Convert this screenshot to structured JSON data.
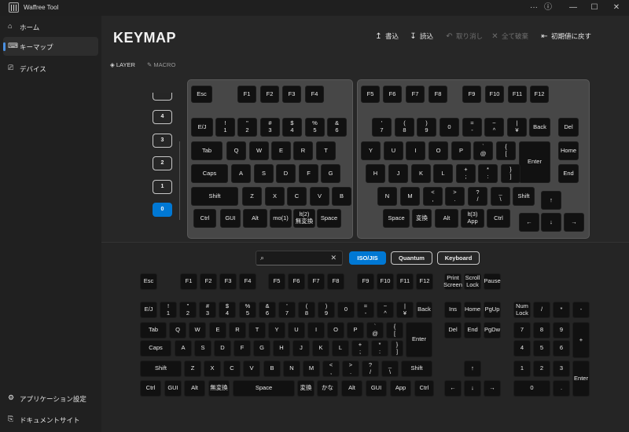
{
  "window": {
    "title": "Waffree Tool",
    "controls": {
      "more": "···",
      "info": "ⓘ",
      "minimize": "—",
      "maximize": "☐",
      "close": "✕"
    }
  },
  "sidebar": {
    "items": [
      {
        "label": "ホーム",
        "icon": "home-icon",
        "glyph": "⌂"
      },
      {
        "label": "キーマップ",
        "icon": "keyboard-icon",
        "glyph": "⌨"
      },
      {
        "label": "デバイス",
        "icon": "device-icon",
        "glyph": "⎚"
      }
    ],
    "footer": [
      {
        "label": "アプリケーション設定",
        "icon": "gear-icon",
        "glyph": "⚙"
      },
      {
        "label": "ドキュメントサイト",
        "icon": "document-icon",
        "glyph": "⎘"
      }
    ]
  },
  "page": {
    "title": "KEYMAP"
  },
  "actions": [
    {
      "label": "書込",
      "glyph": "↥",
      "icon": "upload-icon"
    },
    {
      "label": "読込",
      "glyph": "↧",
      "icon": "download-icon"
    },
    {
      "label": "取り消し",
      "glyph": "↶",
      "icon": "undo-icon"
    },
    {
      "label": "全て破棄",
      "glyph": "✕",
      "icon": "discard-icon"
    },
    {
      "label": "初期値に戻す",
      "glyph": "⇤",
      "icon": "reset-icon"
    }
  ],
  "mode_tabs": [
    {
      "label": "LAYER",
      "glyph": "◈",
      "icon": "layers-icon"
    },
    {
      "label": "MACRO",
      "glyph": "✎",
      "icon": "pen-icon"
    }
  ],
  "layers": [
    "4",
    "3",
    "2",
    "1",
    "0"
  ],
  "active_layer": "0",
  "keymap": {
    "left": [
      [
        "Esc",
        "F1",
        "F2",
        "F3",
        "F4"
      ],
      [
        "E/J",
        "!\n1",
        "\"\n2",
        "#\n3",
        "$\n4",
        "%\n5",
        "&\n6"
      ],
      [
        "Tab",
        "Q",
        "W",
        "E",
        "R",
        "T"
      ],
      [
        "Caps",
        "A",
        "S",
        "D",
        "F",
        "G"
      ],
      [
        "Shift",
        "Z",
        "X",
        "C",
        "V",
        "B"
      ],
      [
        "Ctrl",
        "GUI",
        "Alt",
        "mo(1)",
        "lt(2)\n無変換",
        "Space"
      ]
    ],
    "right": [
      [
        "F5",
        "F6",
        "F7",
        "F8",
        "F9",
        "F10",
        "F11",
        "F12"
      ],
      [
        "'\n7",
        "(\n8",
        ")\n9",
        "0",
        "=\n-",
        "~\n^",
        "|\n¥",
        "Back",
        "Del"
      ],
      [
        "Y",
        "U",
        "I",
        "O",
        "P",
        "`\n@",
        "{\n[",
        "Enter",
        "Home"
      ],
      [
        "H",
        "J",
        "K",
        "L",
        "+\n;",
        "*\n:",
        "}\n]",
        "End"
      ],
      [
        "N",
        "M",
        "<\n,",
        ">\n.",
        "?\n/",
        "_\n\\",
        "Shift",
        "↑"
      ],
      [
        "Space",
        "変換",
        "Alt",
        "lt(3)\nApp",
        "Ctrl",
        "←",
        "↓",
        "→"
      ]
    ]
  },
  "search": {
    "placeholder": "",
    "search_glyph": "⌕",
    "clear_glyph": "✕"
  },
  "filters": [
    {
      "label": "ISO/JIS"
    },
    {
      "label": "Quantum"
    },
    {
      "label": "Keyboard"
    }
  ],
  "active_filter": "ISO/JIS",
  "picker": {
    "fn_row": [
      "Esc",
      "F1",
      "F2",
      "F3",
      "F4",
      "F5",
      "F6",
      "F7",
      "F8",
      "F9",
      "F10",
      "F11",
      "F12",
      "Print\nScreen",
      "Scroll\nLock",
      "Pause"
    ],
    "main": [
      [
        "E/J",
        "!\n1",
        "\"\n2",
        "#\n3",
        "$\n4",
        "%\n5",
        "&\n6",
        "'\n7",
        "(\n8",
        ")\n9",
        "0",
        "=\n-",
        "~\n^",
        "|\n¥",
        "Back"
      ],
      [
        "Tab",
        "Q",
        "W",
        "E",
        "R",
        "T",
        "Y",
        "U",
        "I",
        "O",
        "P",
        "`\n@",
        "{\n[",
        "Enter"
      ],
      [
        "Caps",
        "A",
        "S",
        "D",
        "F",
        "G",
        "H",
        "J",
        "K",
        "L",
        "+\n;",
        "*\n:",
        "}\n]"
      ],
      [
        "Shift",
        "Z",
        "X",
        "C",
        "V",
        "B",
        "N",
        "M",
        "<\n,",
        ">\n.",
        "?\n/",
        "_\n\\",
        "Shift"
      ],
      [
        "Ctrl",
        "GUI",
        "Alt",
        "無変換",
        "Space",
        "変換",
        "かな",
        "Alt",
        "GUI",
        "App",
        "Ctrl"
      ]
    ],
    "nav": [
      "Ins",
      "Home",
      "PgUp",
      "Del",
      "End",
      "PgDw",
      "↑",
      "←",
      "↓",
      "→"
    ],
    "numpad": [
      "Num\nLock",
      "/",
      "*",
      "-",
      "7",
      "8",
      "9",
      "+",
      "4",
      "5",
      "6",
      "1",
      "2",
      "3",
      "Enter",
      "0",
      "."
    ]
  }
}
